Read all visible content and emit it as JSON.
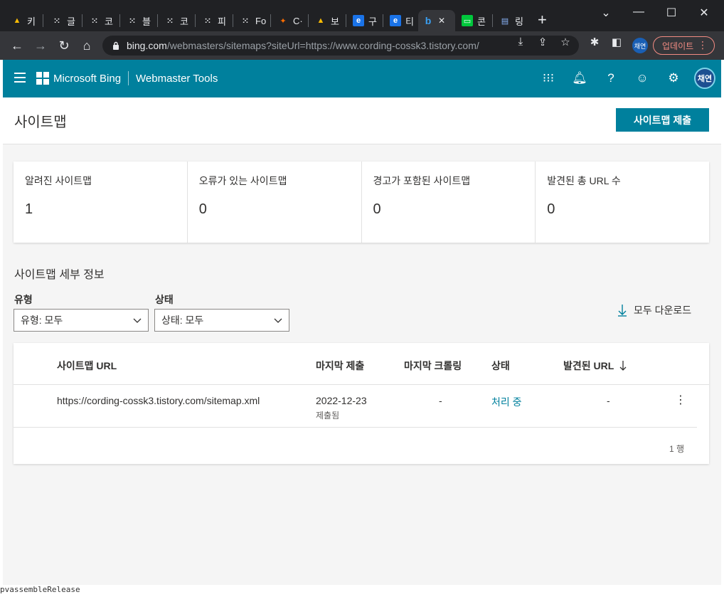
{
  "tabs": [
    {
      "label": "키",
      "icon": "google-ads-icon",
      "color": "#fbbc04"
    },
    {
      "label": "글",
      "icon": "dots-icon",
      "color": "#e8eaed"
    },
    {
      "label": "코",
      "icon": "dots-icon",
      "color": "#e8eaed"
    },
    {
      "label": "블",
      "icon": "dots-icon",
      "color": "#e8eaed"
    },
    {
      "label": "코",
      "icon": "dots-icon",
      "color": "#e8eaed"
    },
    {
      "label": "피",
      "icon": "dots-icon",
      "color": "#e8eaed"
    },
    {
      "label": "Fo",
      "icon": "dots-icon",
      "color": "#e8eaed"
    },
    {
      "label": "C·",
      "icon": "orange-puzzle-icon",
      "color": "#ff6d00"
    },
    {
      "label": "보",
      "icon": "google-ads-icon",
      "color": "#fbbc04"
    },
    {
      "label": "구",
      "icon": "blue-e-icon",
      "color": "#1a73e8"
    },
    {
      "label": "티",
      "icon": "blue-e-icon",
      "color": "#1a73e8"
    },
    {
      "label": "콘",
      "icon": "green-monitor-icon",
      "color": "#00c73c"
    },
    {
      "label": "링",
      "icon": "store-icon",
      "color": "#8ab4f8"
    }
  ],
  "active_tab_close": "✕",
  "address": {
    "host": "bing.com",
    "path": "/webmasters/sitemaps?siteUrl=https://www.cording-cossk3.tistory.com/"
  },
  "profile_initials": "채연",
  "update_label": "업데이트",
  "header": {
    "brand": "Microsoft Bing",
    "product": "Webmaster Tools",
    "avatar": "채연"
  },
  "page": {
    "title": "사이트맵",
    "submit_label": "사이트맵 제출"
  },
  "stats": [
    {
      "label": "알려진 사이트맵",
      "value": "1"
    },
    {
      "label": "오류가 있는 사이트맵",
      "value": "0"
    },
    {
      "label": "경고가 포함된 사이트맵",
      "value": "0"
    },
    {
      "label": "발견된 총 URL 수",
      "value": "0"
    }
  ],
  "details": {
    "title": "사이트맵 세부 정보",
    "type_label": "유형",
    "type_value": "유형: 모두",
    "status_label": "상태",
    "status_value": "상태: 모두",
    "download_label": "모두 다운로드"
  },
  "table": {
    "headers": {
      "url": "사이트맵 URL",
      "last_submitted": "마지막 제출",
      "last_crawled": "마지막 크롤링",
      "status": "상태",
      "found_urls": "발견된 URL"
    },
    "rows": [
      {
        "url": "https://cording-cossk3.tistory.com/sitemap.xml",
        "submitted_date": "2022-12-23",
        "submitted_note": "제출됨",
        "last_crawled": "-",
        "status": "처리 중",
        "found_urls": "-"
      }
    ],
    "row_count": "1 행"
  },
  "bottom_text": "pvassembleRelease",
  "colors": {
    "accent": "#00809d",
    "chrome_dark": "#202124"
  }
}
